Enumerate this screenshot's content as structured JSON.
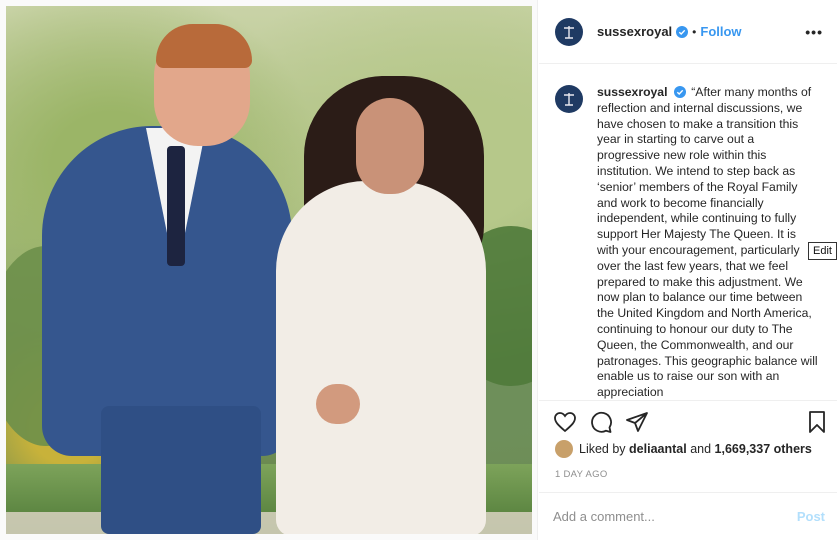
{
  "post": {
    "username": "sussexroyal",
    "follow_label": "Follow",
    "separator": "•",
    "more_label": "•••",
    "caption": "“After many months of reflection and internal discussions, we have chosen to make a transition this year in starting to carve out a progressive new role within this institution. We intend to step back as ‘senior’ members of the Royal Family and work to become financially independent, while continuing to fully support Her Majesty The Queen. It is with your encouragement, particularly over the last few years, that we feel prepared to make this adjustment. We now plan to balance our time between the United Kingdom and North America, continuing to honour our duty to The Queen, the Commonwealth, and our patronages. This geographic balance will enable us to raise our son with an appreciation",
    "tooltip": "Edit",
    "likes": {
      "prefix": "Liked by",
      "user": "deliaantal",
      "and": "and",
      "count": "1,669,337 others"
    },
    "timestamp": "1 DAY AGO",
    "comment": {
      "placeholder": "Add a comment...",
      "post_label": "Post"
    }
  },
  "icons": {
    "verified": "verified-badge-icon",
    "like": "heart-icon",
    "comment": "comment-bubble-icon",
    "share": "paper-plane-icon",
    "save": "bookmark-icon"
  },
  "colors": {
    "accent": "#3897f0",
    "muted": "#8e8e8e",
    "avatar": "#1f3a63"
  }
}
